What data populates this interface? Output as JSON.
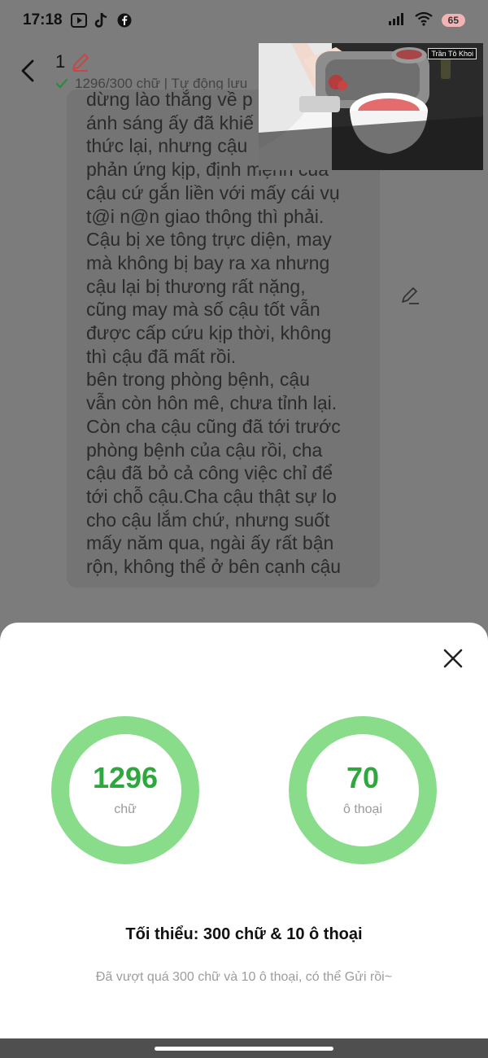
{
  "status_bar": {
    "time": "17:18",
    "battery": "65"
  },
  "header": {
    "chapter_number": "1",
    "save_status": "1296/300 chữ | Tự động lưu"
  },
  "video": {
    "logo_text": "Trần Tô Khoi"
  },
  "story": {
    "text": "dừng lào thắng về p\nánh sáng ấy đã khiế\nthức lại, nhưng cậu\nphản ứng kịp, định mệnh của\ncậu cứ gắn liền với mấy cái vụ\nt@i n@n giao thông thì phải.\nCậu bị xe tông trực diện, may\nmà không bị bay ra xa nhưng\ncậu lại bị thương rất nặng,\ncũng may mà số cậu tốt vẫn\nđược cấp cứu kịp thời, không\nthì cậu đã mất rồi.\nbên trong phòng bệnh, cậu\nvẫn còn hôn mê, chưa tỉnh lại.\nCòn cha cậu cũng đã tới trước\nphòng bệnh của cậu rồi, cha\ncậu đã bỏ cả công việc chỉ để\ntới chỗ cậu.Cha cậu thật sự lo\ncho cậu lắm chứ, nhưng suốt\nmấy năm qua, ngài ấy rất bận\nrộn, không thể ở bên cạnh cậu"
  },
  "sheet": {
    "stats": [
      {
        "value": "1296",
        "label": "chữ"
      },
      {
        "value": "70",
        "label": "ô thoại"
      }
    ],
    "minimum_text": "Tối thiểu: 300 chữ & 10 ô thoại",
    "exceeded_text": "Đã vượt quá 300 chữ và 10 ô thoại, có thể Gửi rồi~"
  },
  "colors": {
    "ring": "#88dc8a",
    "value_text": "#2fa73f",
    "overlay": "#7c7c7c"
  }
}
